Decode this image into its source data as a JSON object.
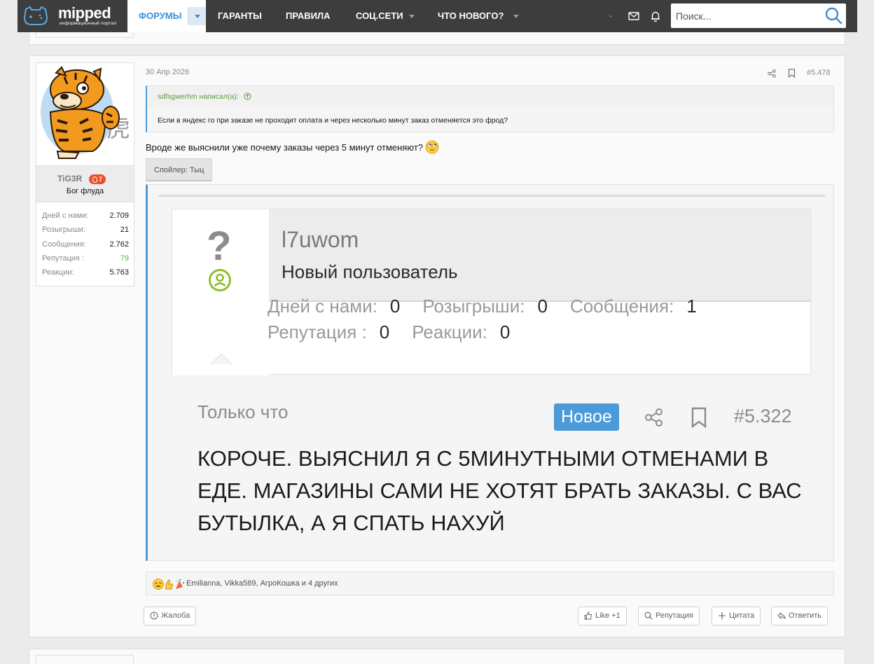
{
  "site": {
    "logo_text": "mipped",
    "logo_sub": "информационный портал"
  },
  "nav": {
    "tabs": [
      {
        "label": "Форумы"
      },
      {
        "label": "Гаранты"
      },
      {
        "label": "Правила"
      },
      {
        "label": "Соц.сети"
      },
      {
        "label": "Что нового?"
      }
    ],
    "search_placeholder": "Поиск..."
  },
  "post": {
    "date": "30 Апр 2026",
    "number": "#5.478",
    "author": {
      "name": "TiG3R",
      "heat": "7",
      "title": "Бог флуда",
      "stats": [
        {
          "label": "Дней с нами:",
          "value": "2.709"
        },
        {
          "label": "Розыгрыши:",
          "value": "21"
        },
        {
          "label": "Сообщения:",
          "value": "2.762"
        },
        {
          "label": "Репутация :",
          "value": "79"
        },
        {
          "label": "Реакции:",
          "value": "5.763"
        }
      ]
    },
    "quote": {
      "author_line": "sdfsgwerhm написал(а):",
      "text": "Если в яндекс го при заказе не проходит оплата и через несколько минут заказ отменяется это фрод?"
    },
    "message": "Вроде же выяснили уже почему заказы через 5 минут отменяют?",
    "spoiler_label": "Спойлер: Тыц",
    "embedded": {
      "username": "l7uwom",
      "role": "Новый пользователь",
      "stats_line1": [
        {
          "label": "Дней с нами:",
          "value": "0"
        },
        {
          "label": "Розыгрыши:",
          "value": "0"
        },
        {
          "label": "Сообщения:",
          "value": "1"
        }
      ],
      "stats_line2": [
        {
          "label": "Репутация :",
          "value": "0"
        },
        {
          "label": "Реакции:",
          "value": "0"
        }
      ],
      "date": "Только что",
      "new_badge": "Новое",
      "number": "#5.322",
      "text": "КОРОЧЕ. ВЫЯСНИЛ Я С 5МИНУТНЫМИ ОТМЕНАМИ В ЕДЕ. МАГАЗИНЫ САМИ НЕ ХОТЯТ БРАТЬ ЗАКАЗЫ. С ВАС БУТЫЛКА, А Я СПАТЬ НАХУЙ"
    },
    "reactions_text": "Emilianna, Vikka589, АгроКошка и 4 других",
    "footer": {
      "report": "Жалоба",
      "like": "Like +1",
      "reputation": "Репутация",
      "quote": "Цитата",
      "reply": "Ответить"
    }
  },
  "colors": {
    "nav_bg": "#3d3d3d",
    "accent": "#4d9ad9",
    "green": "#5cb338",
    "heat_badge": "#e9502f"
  }
}
